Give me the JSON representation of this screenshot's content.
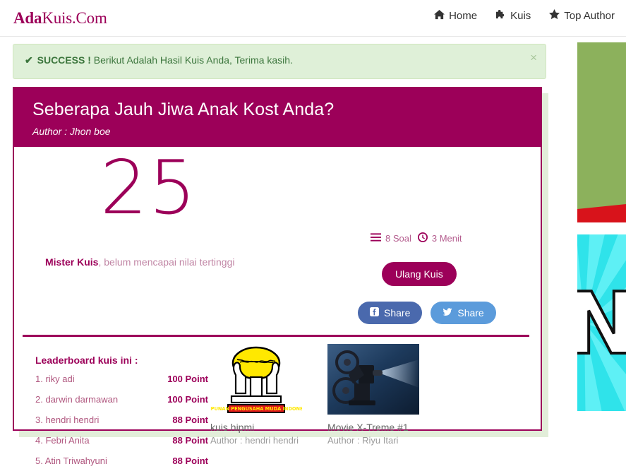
{
  "brand": {
    "bold": "Ada",
    "rest": "Kuis.Com"
  },
  "nav": {
    "items": [
      {
        "label": "Home",
        "icon": "home-icon"
      },
      {
        "label": "Kuis",
        "icon": "puzzle-icon"
      },
      {
        "label": "Top Author",
        "icon": "star-icon"
      }
    ]
  },
  "alert": {
    "check": "✔",
    "label": "SUCCESS !",
    "message": "Berikut Adalah Hasil Kuis Anda, Terima kasih.",
    "close": "×",
    "bg_color": "#dff0d8",
    "text_color": "#3c763d"
  },
  "quiz": {
    "title": "Seberapa Jauh Jiwa Anak Kost Anda?",
    "author": "Author : Jhon boe",
    "accent_color": "#9c0059"
  },
  "result": {
    "score": "25",
    "note_bold": "Mister Kuis",
    "note_rest": ", belum mencapai nilai tertinggi",
    "questions": "8 Soal",
    "questions_icon": "list-icon",
    "duration": "3 Menit",
    "duration_icon": "clock-icon",
    "retry_label": "Ulang Kuis",
    "share_facebook": "Share",
    "share_twitter": "Share",
    "facebook_color": "#4a69ad",
    "twitter_color": "#5b9bdb"
  },
  "leaderboard": {
    "title": "Leaderboard kuis ini :",
    "rows": [
      {
        "name": "1. riky adi",
        "points": "100 Point"
      },
      {
        "name": "2. darwin darmawan",
        "points": "100 Point"
      },
      {
        "name": "3. hendri hendri",
        "points": "88 Point"
      },
      {
        "name": "4. Febri Anita",
        "points": "88 Point"
      },
      {
        "name": "5. Atin Triwahyuni",
        "points": "88 Point"
      }
    ]
  },
  "related_quizzes": [
    {
      "title": "kuis hipmi",
      "author": "Author : hendri hendri",
      "thumb": "hipmi-logo-thumbnail"
    },
    {
      "title": "Movie X-Treme #1",
      "author": "Author : Riyu Itari",
      "thumb": "film-projector-thumbnail"
    }
  ],
  "ads": [
    {
      "name": "green-banner-ad",
      "color": "#8cb15c",
      "accent": "#d8131b"
    },
    {
      "name": "cyan-sunburst-ad",
      "color": "#2fe3ea",
      "letter": "N"
    }
  ]
}
